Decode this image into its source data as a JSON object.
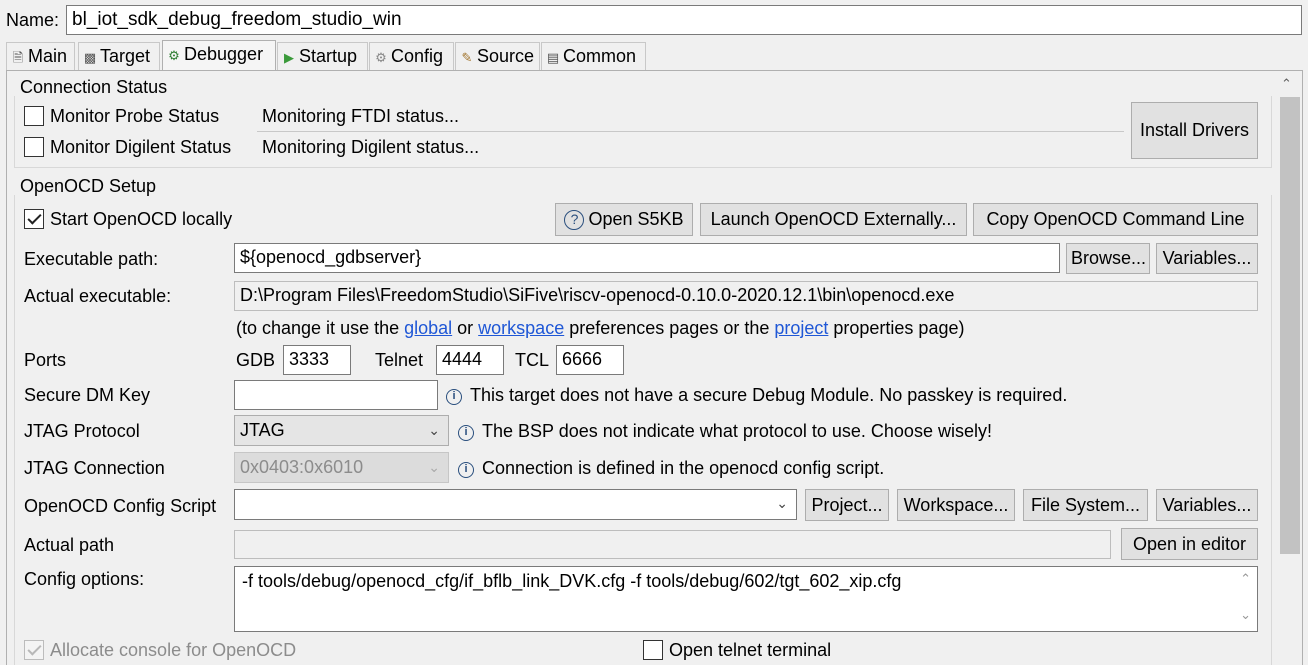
{
  "name_label": "Name:",
  "name_value": "bl_iot_sdk_debug_freedom_studio_win",
  "tabs": [
    {
      "label": "Main",
      "icon": "main-icon"
    },
    {
      "label": "Target",
      "icon": "target-icon"
    },
    {
      "label": "Debugger",
      "icon": "debugger-icon",
      "active": true
    },
    {
      "label": "Startup",
      "icon": "startup-icon"
    },
    {
      "label": "Config",
      "icon": "config-icon"
    },
    {
      "label": "Source",
      "icon": "source-icon"
    },
    {
      "label": "Common",
      "icon": "common-icon"
    }
  ],
  "connection_status": {
    "title": "Connection Status",
    "monitor_probe_label": "Monitor  Probe Status",
    "monitor_probe_value": "Monitoring FTDI status...",
    "monitor_digilent_label": "Monitor Digilent Status",
    "monitor_digilent_value": "Monitoring Digilent status...",
    "install_drivers": "Install Drivers"
  },
  "openocd_setup": {
    "title": "OpenOCD Setup",
    "start_locally": "Start OpenOCD locally",
    "open_s5kb": "Open S5KB",
    "launch_externally": "Launch OpenOCD Externally...",
    "copy_command": "Copy OpenOCD Command Line",
    "exec_path_label": "Executable path:",
    "exec_path_value": "${openocd_gdbserver}",
    "browse": "Browse...",
    "variables": "Variables...",
    "actual_exec_label": "Actual executable:",
    "actual_exec_value": "D:\\Program Files\\FreedomStudio\\SiFive\\riscv-openocd-0.10.0-2020.12.1\\bin\\openocd.exe",
    "hint_pre": "(to change it use the ",
    "hint_global": "global",
    "hint_or": " or ",
    "hint_workspace": "workspace",
    "hint_mid": " preferences pages or the ",
    "hint_project": "project",
    "hint_post": " properties page)",
    "ports_label": "Ports",
    "gdb_label": "GDB",
    "gdb_value": "3333",
    "telnet_label": "Telnet",
    "telnet_value": "4444",
    "tcl_label": "TCL",
    "tcl_value": "6666",
    "secure_dm_label": "Secure DM Key",
    "secure_dm_value": "",
    "secure_dm_info": "This target does not have a secure Debug Module. No passkey is required.",
    "jtag_protocol_label": "JTAG Protocol",
    "jtag_protocol_value": "JTAG",
    "jtag_protocol_info": "The BSP does not indicate what protocol to use. Choose wisely!",
    "jtag_connection_label": "JTAG Connection",
    "jtag_connection_value": "0x0403:0x6010",
    "jtag_connection_info": "Connection is defined in the openocd config script.",
    "config_script_label": "OpenOCD Config Script",
    "config_script_value": "",
    "project_btn": "Project...",
    "workspace_btn": "Workspace...",
    "filesystem_btn": "File System...",
    "variables2_btn": "Variables...",
    "actual_path_label": "Actual path",
    "actual_path_value": "",
    "open_in_editor": "Open in editor",
    "config_options_label": "Config options:",
    "config_options_value": "-f tools/debug/openocd_cfg/if_bflb_link_DVK.cfg -f tools/debug/602/tgt_602_xip.cfg",
    "allocate_console": "Allocate console for OpenOCD",
    "open_telnet": "Open telnet terminal"
  }
}
